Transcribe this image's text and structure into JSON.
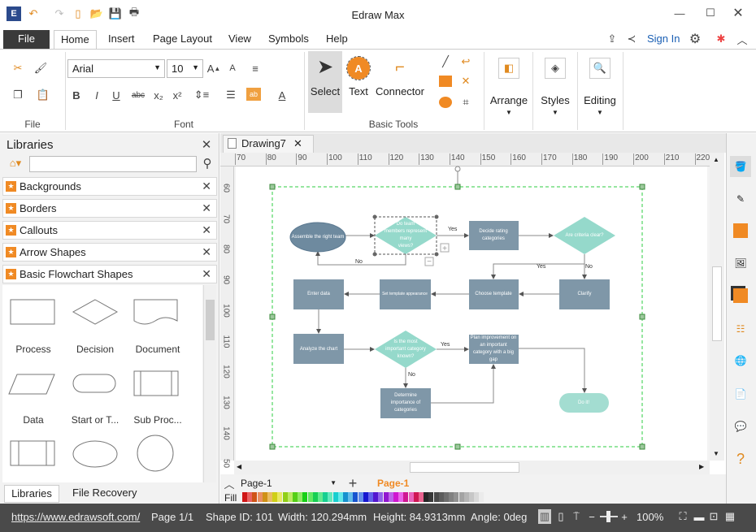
{
  "app": {
    "title": "Edraw Max"
  },
  "menu": {
    "file": "File",
    "tabs": [
      "Home",
      "Insert",
      "Page Layout",
      "View",
      "Symbols",
      "Help"
    ],
    "sign_in": "Sign In"
  },
  "ribbon": {
    "font_name": "Arial",
    "font_size": "10",
    "groups": {
      "file": "File",
      "font": "Font",
      "basic_tools": "Basic Tools"
    },
    "tools": {
      "select": "Select",
      "text": "Text",
      "connector": "Connector",
      "arrange": "Arrange",
      "styles": "Styles",
      "editing": "Editing"
    }
  },
  "libraries": {
    "title": "Libraries",
    "search_placeholder": "",
    "items": [
      "Backgrounds",
      "Borders",
      "Callouts",
      "Arrow Shapes",
      "Basic Flowchart Shapes"
    ],
    "shapes": [
      "Process",
      "Decision",
      "Document",
      "Data",
      "Start or T...",
      "Sub Proc...",
      "",
      "",
      ""
    ],
    "bottom_tabs": [
      "Libraries",
      "File Recovery"
    ]
  },
  "document": {
    "tab": "Drawing7",
    "ruler_top": [
      "70",
      "80",
      "90",
      "100",
      "110",
      "120",
      "130",
      "140",
      "150",
      "160",
      "170",
      "180",
      "190",
      "200",
      "210",
      "220"
    ],
    "ruler_left": [
      "60",
      "70",
      "80",
      "90",
      "100",
      "110",
      "120",
      "130",
      "140",
      "50"
    ]
  },
  "flowchart": {
    "assemble": "Assemble the right team",
    "d1": [
      "Do team",
      "members represent",
      "many",
      "views?"
    ],
    "decide": [
      "Decide rating",
      "categories"
    ],
    "d2": "Are criteria clear?",
    "clarify": "Clarify",
    "choose": "Choose template",
    "set": "Set template appearance",
    "enter": "Enter data",
    "analyze": "Analyze the chart",
    "d3": [
      "Is the most",
      "important category",
      "known?"
    ],
    "plan": [
      "Plan improvement on",
      "an important",
      "category with a big",
      "gap"
    ],
    "determine": [
      "Determine",
      "importance of",
      "categories"
    ],
    "doit": "Do it!",
    "yes": "Yes",
    "no": "No"
  },
  "colors": {
    "process": "#7f97a8",
    "terminator": "#6e8a9f",
    "decision": "#95d9cb",
    "doit": "#a3ddd1",
    "selection": "#2ecc40",
    "accent": "#f08a24"
  },
  "pages": {
    "selector": "Page-1",
    "active": "Page-1",
    "fill_label": "Fill"
  },
  "status": {
    "url": "https://www.edrawsoft.com/",
    "page": "Page 1/1",
    "shape_id": "Shape ID: 101",
    "width": "Width: 120.294mm",
    "height": "Height: 84.9313mm",
    "angle": "Angle: 0deg",
    "zoom": "100%"
  }
}
